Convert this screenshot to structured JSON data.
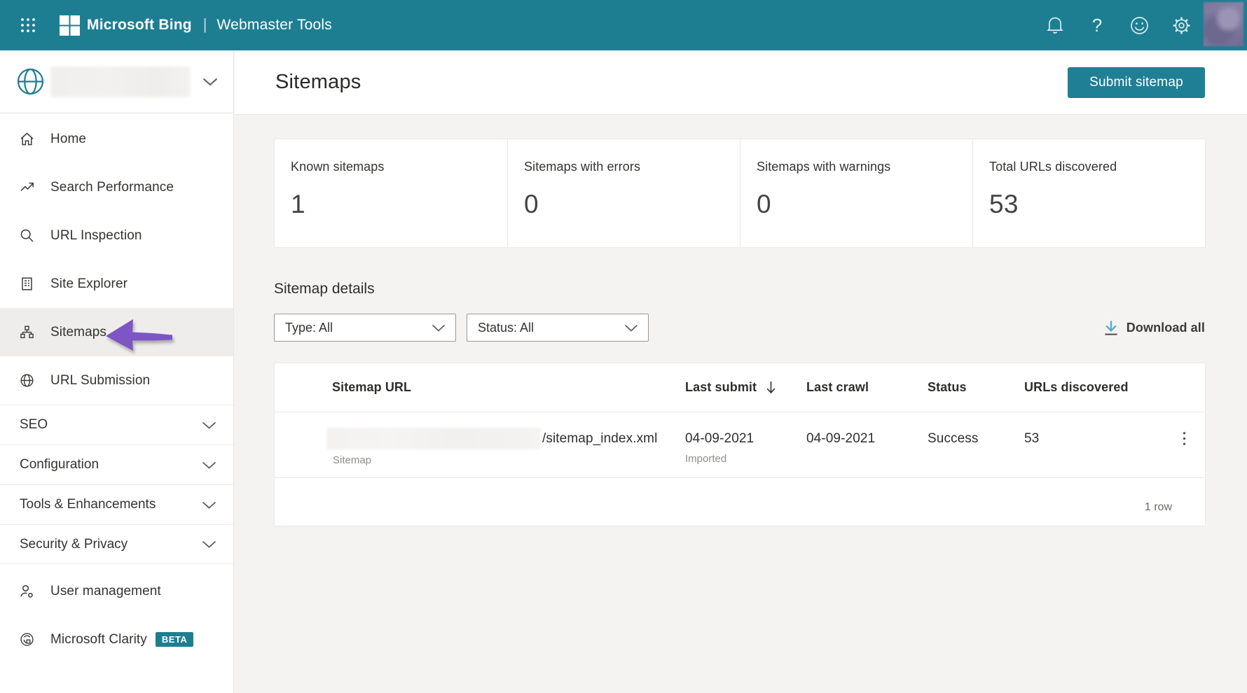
{
  "colors": {
    "topbar": "#1d7e92",
    "accent_teal": "#1f7f94",
    "arrow_purple": "#7d55c5",
    "background": "#f4f3f2"
  },
  "topbar": {
    "brand": "Microsoft Bing",
    "separator": "|",
    "product": "Webmaster Tools",
    "icons": [
      "waffle-menu",
      "notifications-bell",
      "help",
      "feedback-smiley",
      "settings-gear",
      "avatar"
    ]
  },
  "sidebar": {
    "site_selector": {
      "icon": "globe",
      "label_state": "redacted-site-name"
    },
    "items": [
      {
        "label": "Home",
        "icon": "home",
        "selected": false
      },
      {
        "label": "Search Performance",
        "icon": "trending-up",
        "selected": false
      },
      {
        "label": "URL Inspection",
        "icon": "magnifier",
        "selected": false
      },
      {
        "label": "Site Explorer",
        "icon": "site-list",
        "selected": false
      },
      {
        "label": "Sitemaps",
        "icon": "sitemap-hierarchy",
        "selected": true
      },
      {
        "label": "URL Submission",
        "icon": "globe",
        "selected": false
      }
    ],
    "sections": [
      {
        "label": "SEO"
      },
      {
        "label": "Configuration"
      },
      {
        "label": "Tools & Enhancements"
      },
      {
        "label": "Security & Privacy"
      }
    ],
    "footer_items": [
      {
        "label": "User management",
        "icon": "user"
      },
      {
        "label": "Microsoft Clarity",
        "icon": "clarity-logo",
        "badge": "BETA"
      }
    ]
  },
  "header": {
    "title": "Sitemaps",
    "submit_button": "Submit sitemap"
  },
  "stats": [
    {
      "label": "Known sitemaps",
      "value": "1"
    },
    {
      "label": "Sitemaps with errors",
      "value": "0"
    },
    {
      "label": "Sitemaps with warnings",
      "value": "0"
    },
    {
      "label": "Total URLs discovered",
      "value": "53"
    }
  ],
  "details": {
    "title": "Sitemap details",
    "filters": [
      {
        "label": "Type: All"
      },
      {
        "label": "Status: All"
      }
    ],
    "download_all": "Download all",
    "table": {
      "columns": [
        "Sitemap URL",
        "Last submit",
        "Last crawl",
        "Status",
        "URLs discovered"
      ],
      "sorted_column": "Last submit",
      "row": {
        "url_redacted": true,
        "url_suffix": "/sitemap_index.xml",
        "url_type": "Sitemap",
        "last_submit": "04-09-2021",
        "last_submit_note": "Imported",
        "last_crawl": "04-09-2021",
        "status": "Success",
        "urls_discovered": "53"
      },
      "footer": "1 row"
    }
  }
}
